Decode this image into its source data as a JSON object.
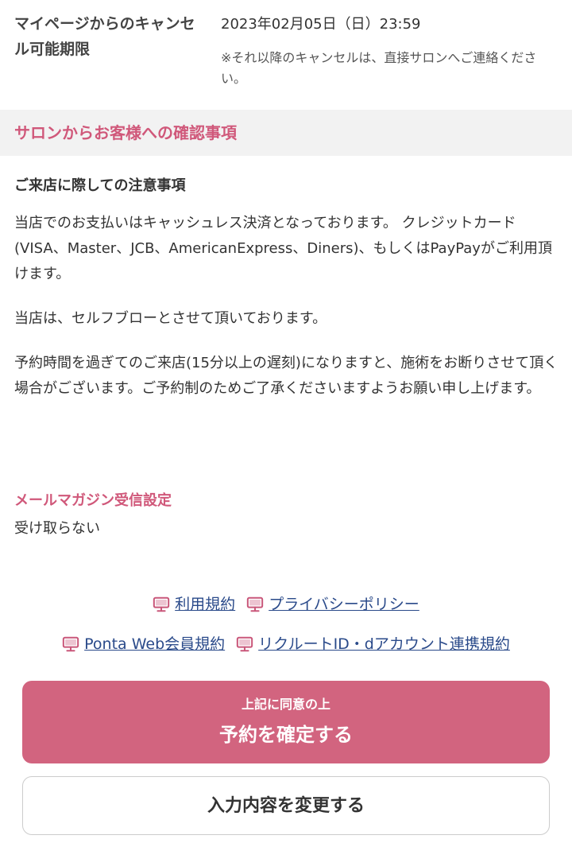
{
  "cancel": {
    "label": "マイページからのキャンセル可能期限",
    "deadline": "2023年02月05日（日）23:59",
    "note": "※それ以降のキャンセルは、直接サロンへご連絡ください。"
  },
  "confirm_section": {
    "title": "サロンからお客様への確認事項"
  },
  "notes": {
    "title": "ご来店に際しての注意事項",
    "paragraphs": [
      "当店でのお支払いはキャッシュレス決済となっております。 クレジットカード(VISA、Master、JCB、AmericanExpress、Diners)、もしくはPayPayがご利用頂けます。",
      "当店は、セルフブローとさせて頂いております。",
      "予約時間を過ぎてのご来店(15分以上の遅刻)になりますと、施術をお断りさせて頂く場合がございます。ご予約制のためご了承くださいますようお願い申し上げます。"
    ]
  },
  "mail": {
    "title": "メールマガジン受信設定",
    "value": "受け取らない"
  },
  "links": {
    "terms": "利用規約",
    "privacy": "プライバシーポリシー",
    "ponta": "Ponta Web会員規約",
    "recruit": "リクルートID・dアカウント連携規約"
  },
  "buttons": {
    "confirm_sub": "上記に同意の上",
    "confirm_main": "予約を確定する",
    "change": "入力内容を変更する"
  },
  "colors": {
    "accent": "#d0587a",
    "button": "#d2647f",
    "link": "#2a4a8a"
  },
  "icons": {
    "link_icon": "monitor-icon"
  }
}
